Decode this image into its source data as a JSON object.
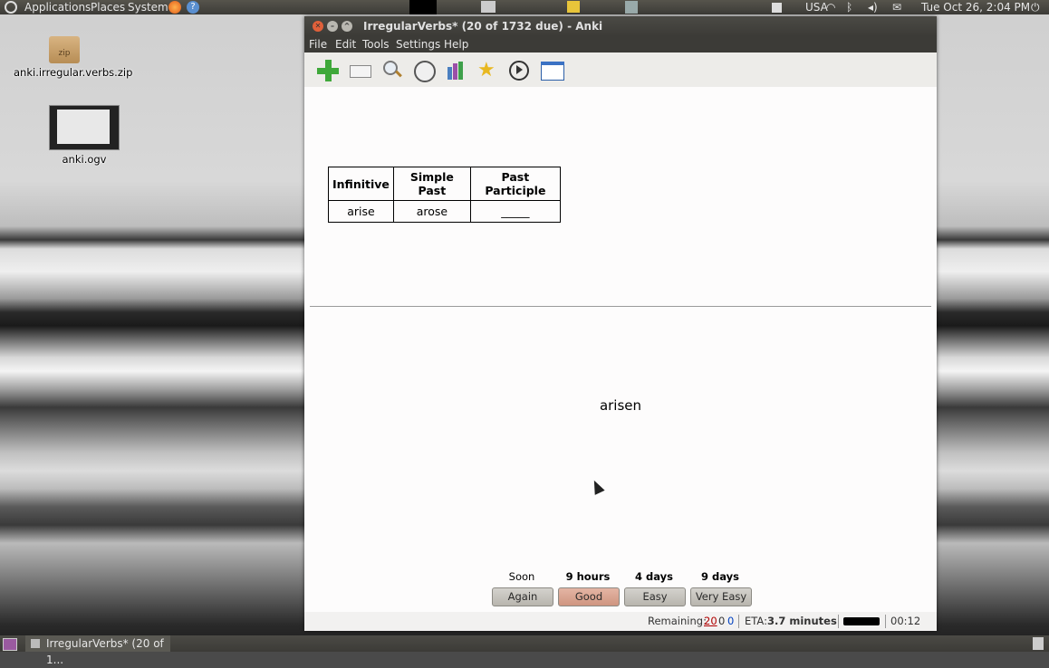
{
  "top_panel": {
    "menus": [
      "Applications",
      "Places",
      "System"
    ],
    "keyboard_layout": "USA",
    "clock": "Tue Oct 26,  2:04 PM"
  },
  "desktop_icons": [
    {
      "label": "anki.irregular.verbs.zip",
      "badge": "zip",
      "icon": "zip-archive-icon"
    },
    {
      "label": "anki.ogv",
      "icon": "video-thumbnail-icon"
    }
  ],
  "window": {
    "title": "IrregularVerbs* (20 of 1732 due) - Anki",
    "menu": [
      "File",
      "Edit",
      "Tools",
      "Settings",
      "Help"
    ],
    "toolbar": [
      "add-icon",
      "edit-card-icon",
      "search-icon",
      "timer-icon",
      "stats-icon",
      "star-icon",
      "play-icon",
      "list-icon"
    ],
    "card": {
      "table_headers": [
        "Infinitive",
        "Simple Past",
        "Past Participle"
      ],
      "table_row": [
        "arise",
        "arose",
        "_____"
      ],
      "answer": "arisen"
    },
    "ease": {
      "intervals": [
        "Soon",
        "9 hours",
        "4 days",
        "9 days"
      ],
      "buttons": [
        "Again",
        "Good",
        "Easy",
        "Very Easy"
      ],
      "button_colors": [
        "#c9c6be",
        "#d9a593",
        "#c9c6be",
        "#c9c6be"
      ]
    },
    "status": {
      "remaining_label": "Remaining:",
      "remaining_new": "20",
      "remaining_review": "0",
      "remaining_learn": "0",
      "eta_label": "ETA:",
      "eta_value": "3.7 minutes",
      "timer": "00:12"
    }
  },
  "taskbar": {
    "task_label": "IrregularVerbs* (20 of 1..."
  }
}
